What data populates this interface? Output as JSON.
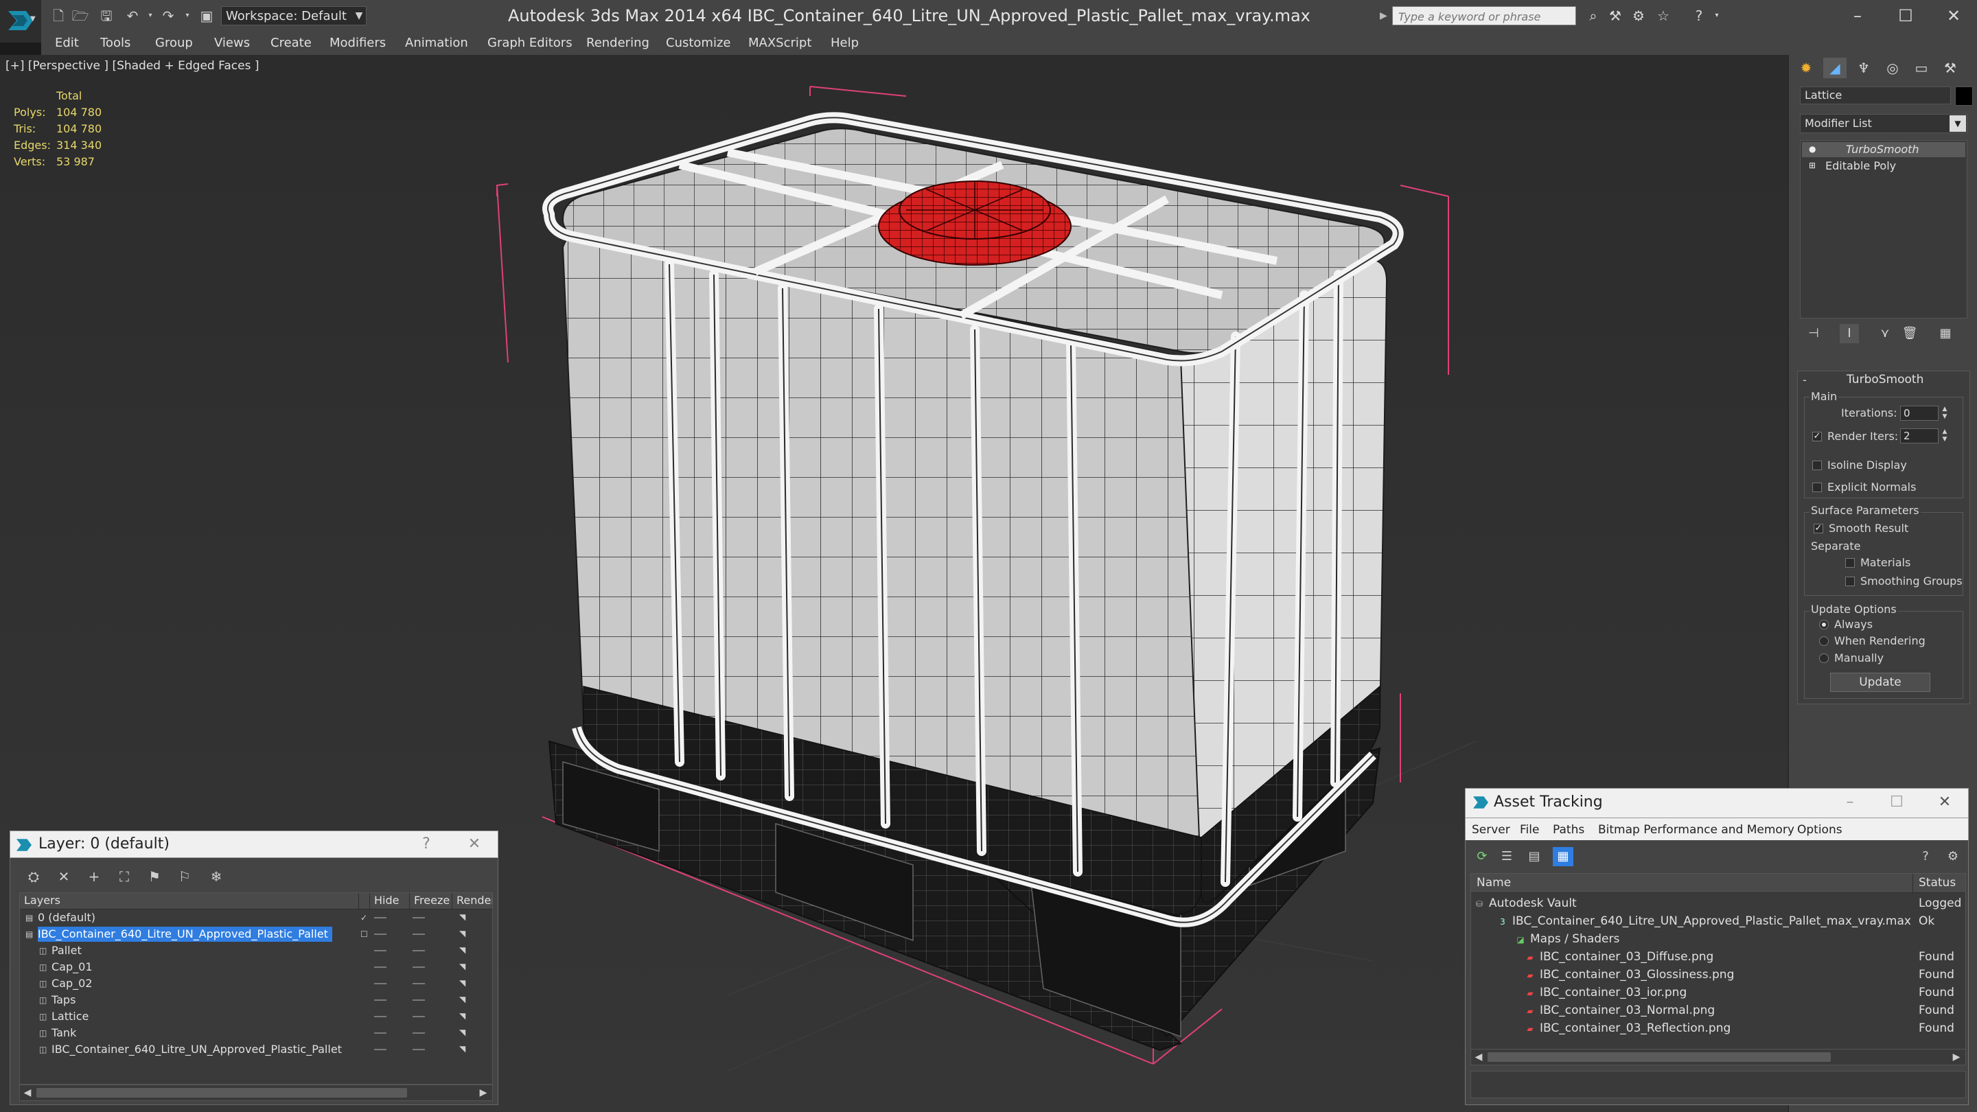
{
  "title_bar": {
    "workspace_label": "Workspace: Default",
    "window_title": "Autodesk 3ds Max  2014 x64      IBC_Container_640_Litre_UN_Approved_Plastic_Pallet_max_vray.max",
    "search_placeholder": "Type a keyword or phrase"
  },
  "menu": [
    "Edit",
    "Tools",
    "Group",
    "Views",
    "Create",
    "Modifiers",
    "Animation",
    "Graph Editors",
    "Rendering",
    "Customize",
    "MAXScript",
    "Help"
  ],
  "viewport": {
    "label": "[+] [Perspective ] [Shaded + Edged Faces ]",
    "stats_header": "Total",
    "stats": [
      {
        "label": "Polys:",
        "value": "104 780"
      },
      {
        "label": "Tris:",
        "value": "104 780"
      },
      {
        "label": "Edges:",
        "value": "314 340"
      },
      {
        "label": "Verts:",
        "value": "53 987"
      }
    ]
  },
  "command_panel": {
    "object_name": "Lattice",
    "modifier_list": "Modifier List",
    "stack": [
      "TurboSmooth",
      "Editable Poly"
    ],
    "rollout_title": "TurboSmooth",
    "main_label": "Main",
    "iterations_label": "Iterations:",
    "iterations_value": "0",
    "render_iters_label": "Render Iters:",
    "render_iters_value": "2",
    "isoline_label": "Isoline Display",
    "explicit_normals_label": "Explicit Normals",
    "surface_label": "Surface Parameters",
    "smooth_result_label": "Smooth Result",
    "separate_label": "Separate",
    "materials_label": "Materials",
    "smoothing_groups_label": "Smoothing Groups",
    "update_options_label": "Update Options",
    "always_label": "Always",
    "when_rendering_label": "When Rendering",
    "manually_label": "Manually",
    "update_button": "Update"
  },
  "layer_window": {
    "title": "Layer: 0 (default)",
    "help": "?",
    "columns": [
      "Layers",
      "Hide",
      "Freeze",
      "Render"
    ],
    "rows": [
      {
        "name": "0 (default)",
        "level": 0
      },
      {
        "name": "IBC_Container_640_Litre_UN_Approved_Plastic_Pallet",
        "level": 0
      },
      {
        "name": "Pallet",
        "level": 1
      },
      {
        "name": "Cap_01",
        "level": 1
      },
      {
        "name": "Cap_02",
        "level": 1
      },
      {
        "name": "Taps",
        "level": 1
      },
      {
        "name": "Lattice",
        "level": 1
      },
      {
        "name": "Tank",
        "level": 1
      },
      {
        "name": "IBC_Container_640_Litre_UN_Approved_Plastic_Pallet",
        "level": 1
      }
    ]
  },
  "asset_window": {
    "title": "Asset Tracking",
    "menu": [
      "Server",
      "File",
      "Paths",
      "Bitmap Performance and Memory",
      "Options"
    ],
    "columns": [
      "Name",
      "Status"
    ],
    "rows": [
      {
        "name": "Autodesk Vault",
        "status": "Logged O",
        "level": 0
      },
      {
        "name": "IBC_Container_640_Litre_UN_Approved_Plastic_Pallet_max_vray.max",
        "status": "Ok",
        "level": 1
      },
      {
        "name": "Maps / Shaders",
        "status": "",
        "level": 2
      },
      {
        "name": "IBC_container_03_Diffuse.png",
        "status": "Found",
        "level": 3
      },
      {
        "name": "IBC_container_03_Glossiness.png",
        "status": "Found",
        "level": 3
      },
      {
        "name": "IBC_container_03_ior.png",
        "status": "Found",
        "level": 3
      },
      {
        "name": "IBC_container_03_Normal.png",
        "status": "Found",
        "level": 3
      },
      {
        "name": "IBC_container_03_Reflection.png",
        "status": "Found",
        "level": 3
      }
    ]
  },
  "colors": {
    "selection": "#2f7de1",
    "stats_text": "#e8d86a",
    "cap_red": "#d02020",
    "bbox_pink": "#e0407a"
  }
}
